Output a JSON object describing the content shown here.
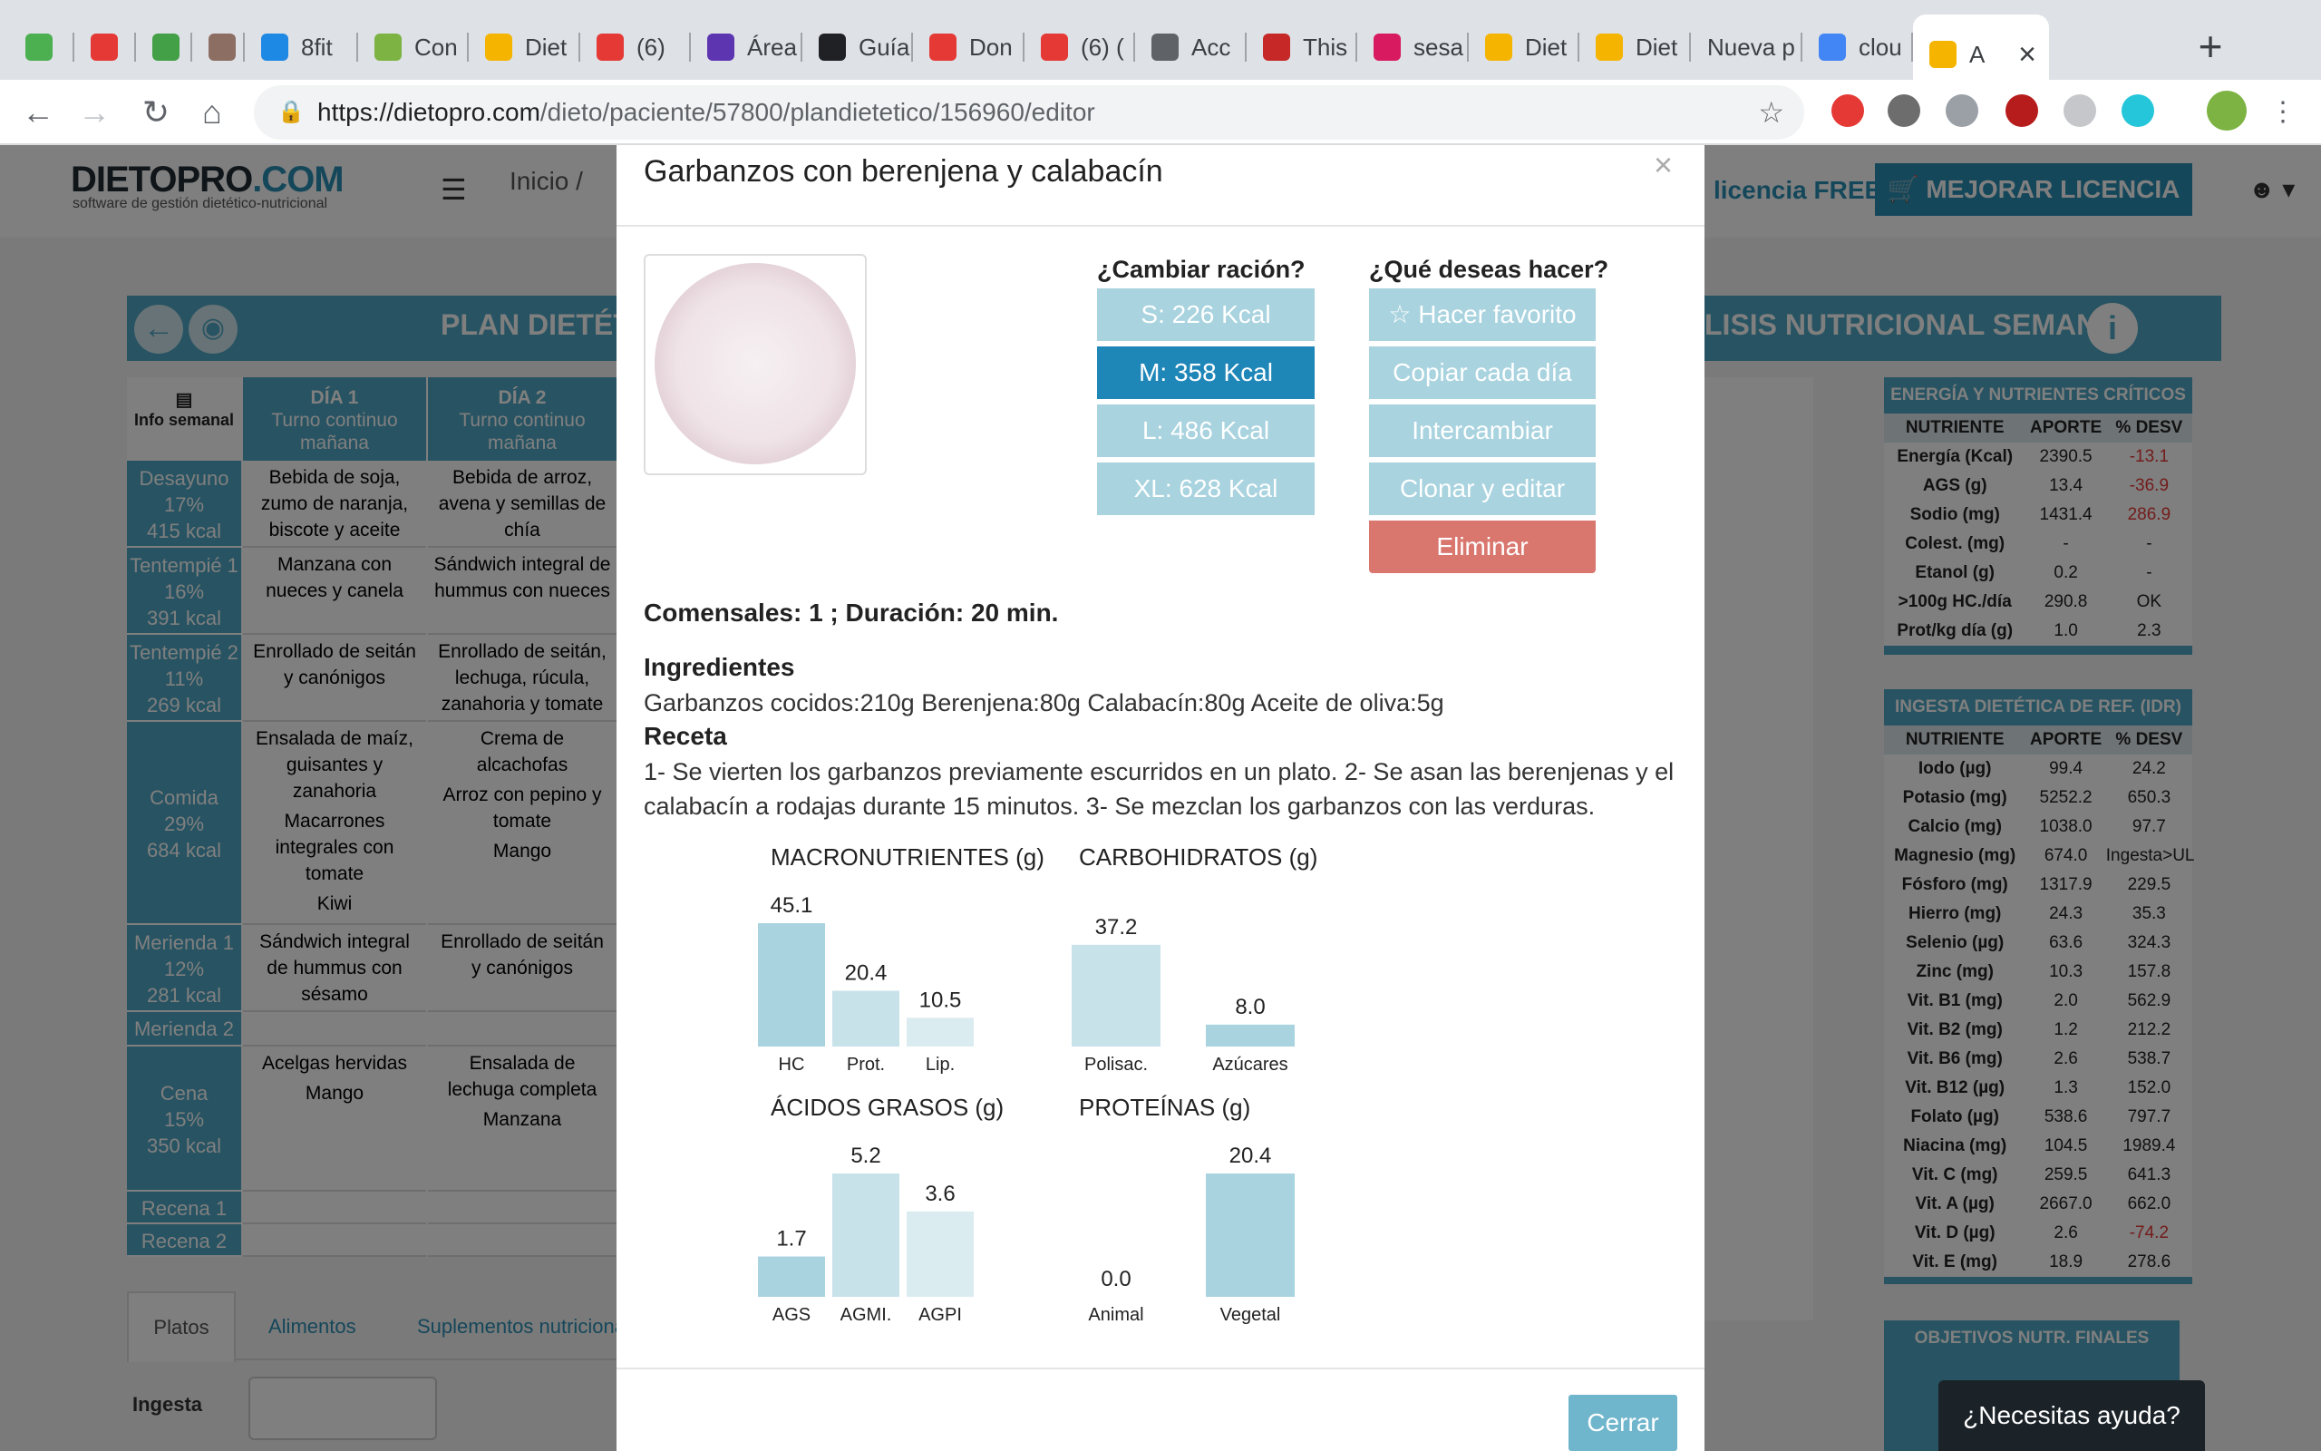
{
  "browser": {
    "tabs": [
      {
        "label": "",
        "color": "#4caf50"
      },
      {
        "label": "",
        "color": "#e53935"
      },
      {
        "label": "",
        "color": "#43a047"
      },
      {
        "label": "",
        "color": "#8d6e63"
      },
      {
        "label": "8fit",
        "color": "#1e88e5"
      },
      {
        "label": "Con",
        "color": "#7cb342"
      },
      {
        "label": "Diet",
        "color": "#f4b400"
      },
      {
        "label": "(6)",
        "color": "#e53935"
      },
      {
        "label": "Área",
        "color": "#5e35b1"
      },
      {
        "label": "Guía",
        "color": "#202124"
      },
      {
        "label": "Don",
        "color": "#e53935"
      },
      {
        "label": "(6) (",
        "color": "#e53935"
      },
      {
        "label": "Acc",
        "color": "#5f6368"
      },
      {
        "label": "This",
        "color": "#c62828"
      },
      {
        "label": "sesa",
        "color": "#d81b60"
      },
      {
        "label": "Diet",
        "color": "#f4b400"
      },
      {
        "label": "Diet",
        "color": "#f4b400"
      },
      {
        "label": "Nueva p",
        "color": ""
      },
      {
        "label": "clou",
        "color": "#4285f4"
      },
      {
        "label": "A",
        "color": "#f4b400"
      }
    ],
    "new_tab": "+",
    "close_tab": "×",
    "url_host": "https://dietopro.com",
    "url_path": "/dieto/paciente/57800/plandietetico/156960/editor"
  },
  "site": {
    "logo": "DIETOPRO",
    "logo_suffix": ".COM",
    "logo_sub": "software de gestión dietético-nutricional",
    "breadcrumb": "Inicio /",
    "licence": "licencia FREE",
    "upgrade": "MEJORAR LICENCIA",
    "plan_title": "PLAN DIETÉTI",
    "analysis_title": "LISIS NUTRICIONAL SEMANAL",
    "info_semanal": "Info semanal",
    "day1": "DÍA 1",
    "day1_sub": "Turno continuo mañana",
    "day2": "DÍA 2",
    "day2_sub": "Turno continuo mañana",
    "meals": [
      {
        "name": "Desayuno",
        "pct": "17%",
        "kcal": "415 kcal",
        "d1": "Bebida de soja, zumo de naranja, biscote y aceite",
        "d2": "Bebida de arroz, avena y semillas de chía"
      },
      {
        "name": "Tentempié 1",
        "pct": "16%",
        "kcal": "391 kcal",
        "d1": "Manzana con nueces y canela",
        "d2": "Sándwich integral de hummus con nueces"
      },
      {
        "name": "Tentempié 2",
        "pct": "11%",
        "kcal": "269 kcal",
        "d1": "Enrollado de seitán y canónigos",
        "d2": "Enrollado de seitán, lechuga, rúcula, zanahoria y tomate"
      },
      {
        "name": "Comida",
        "pct": "29%",
        "kcal": "684 kcal",
        "d1": "Ensalada de maíz, guisantes y zanahoria / Macarrones integrales con tomate / Kiwi",
        "d2": "Crema de alcachofas / Arroz con pepino y tomate / Mango"
      },
      {
        "name": "Merienda 1",
        "pct": "12%",
        "kcal": "281 kcal",
        "d1": "Sándwich integral de hummus con sésamo",
        "d2": "Enrollado de seitán y canónigos"
      },
      {
        "name": "Merienda 2",
        "pct": "",
        "kcal": "",
        "d1": "",
        "d2": ""
      },
      {
        "name": "Cena",
        "pct": "15%",
        "kcal": "350 kcal",
        "d1": "Acelgas hervidas / Mango",
        "d2": "Ensalada de lechuga completa / Manzana"
      },
      {
        "name": "Recena 1",
        "pct": "",
        "kcal": "",
        "d1": "",
        "d2": ""
      },
      {
        "name": "Recena 2",
        "pct": "",
        "kcal": "",
        "d1": "",
        "d2": ""
      }
    ],
    "bottom_tabs": [
      "Platos",
      "Alimentos",
      "Suplementos nutriciona"
    ],
    "ingesta_label": "Ingesta",
    "energy_table": {
      "title": "ENERGÍA Y NUTRIENTES CRÍTICOS",
      "headers": [
        "NUTRIENTE",
        "APORTE",
        "% DESV"
      ],
      "rows": [
        [
          "Energía (Kcal)",
          "2390.5",
          "-13.1"
        ],
        [
          "AGS (g)",
          "13.4",
          "-36.9"
        ],
        [
          "Sodio (mg)",
          "1431.4",
          "286.9"
        ],
        [
          "Colest. (mg)",
          "-",
          "-"
        ],
        [
          "Etanol (g)",
          "0.2",
          "-"
        ],
        [
          ">100g HC./día",
          "290.8",
          "OK"
        ],
        [
          "Prot/kg día (g)",
          "1.0",
          "2.3"
        ]
      ]
    },
    "idr_table": {
      "title": "INGESTA DIETÉTICA DE REF. (IDR)",
      "headers": [
        "NUTRIENTE",
        "APORTE",
        "% DESV"
      ],
      "rows": [
        [
          "Iodo (µg)",
          "99.4",
          "24.2"
        ],
        [
          "Potasio (mg)",
          "5252.2",
          "650.3"
        ],
        [
          "Calcio (mg)",
          "1038.0",
          "97.7"
        ],
        [
          "Magnesio (mg)",
          "674.0",
          "Ingesta>UL"
        ],
        [
          "Fósforo (mg)",
          "1317.9",
          "229.5"
        ],
        [
          "Hierro (mg)",
          "24.3",
          "35.3"
        ],
        [
          "Selenio (µg)",
          "63.6",
          "324.3"
        ],
        [
          "Zinc (mg)",
          "10.3",
          "157.8"
        ],
        [
          "Vit. B1 (mg)",
          "2.0",
          "562.9"
        ],
        [
          "Vit. B2 (mg)",
          "1.2",
          "212.2"
        ],
        [
          "Vit. B6 (mg)",
          "2.6",
          "538.7"
        ],
        [
          "Vit. B12 (µg)",
          "1.3",
          "152.0"
        ],
        [
          "Folato (µg)",
          "538.6",
          "797.7"
        ],
        [
          "Niacina (mg)",
          "104.5",
          "1989.4"
        ],
        [
          "Vit. C (mg)",
          "259.5",
          "641.3"
        ],
        [
          "Vit. A (µg)",
          "2667.0",
          "662.0"
        ],
        [
          "Vit. D (µg)",
          "2.6",
          "-74.2"
        ],
        [
          "Vit. E (mg)",
          "18.9",
          "278.6"
        ]
      ]
    },
    "objectives_title": "OBJETIVOS NUTR. FINALES",
    "help": "¿Necesitas ayuda?"
  },
  "modal": {
    "title": "Garbanzos con berenjena y calabacín",
    "close_x": "×",
    "portion_heading": "¿Cambiar ración?",
    "portions": [
      {
        "label": "S: 226 Kcal",
        "selected": false
      },
      {
        "label": "M: 358 Kcal",
        "selected": true
      },
      {
        "label": "L: 486 Kcal",
        "selected": false
      },
      {
        "label": "XL: 628 Kcal",
        "selected": false
      }
    ],
    "actions_heading": "¿Qué deseas hacer?",
    "actions": {
      "favorite": "Hacer favorito",
      "copy": "Copiar cada día",
      "swap": "Intercambiar",
      "clone": "Clonar y editar",
      "delete": "Eliminar"
    },
    "meta": "Comensales: 1 ; Duración: 20 min.",
    "ingredients_heading": "Ingredientes",
    "ingredients": "Garbanzos cocidos:210g Berenjena:80g Calabacín:80g Aceite de oliva:5g",
    "recipe_heading": "Receta",
    "recipe": "1- Se vierten los garbanzos previamente escurridos en un plato. 2- Se asan las berenjenas y el calabacín a rodajas durante 15 minutos. 3- Se mezclan los garbanzos con las verduras.",
    "close_button": "Cerrar",
    "colors": {
      "bar_dark": "#a8d3df",
      "bar_mid": "#c8e2ea",
      "bar_light": "#dbecf1",
      "accent": "#1f86b8",
      "danger": "#d9776f"
    }
  },
  "chart_data": [
    {
      "type": "bar",
      "title": "MACRONUTRIENTES (g)",
      "categories": [
        "HC",
        "Prot.",
        "Lip."
      ],
      "values": [
        45.1,
        20.4,
        10.5
      ]
    },
    {
      "type": "bar",
      "title": "CARBOHIDRATOS (g)",
      "categories": [
        "Polisac.",
        "Azúcares"
      ],
      "values": [
        37.2,
        8.0
      ]
    },
    {
      "type": "bar",
      "title": "ÁCIDOS GRASOS (g)",
      "categories": [
        "AGS",
        "AGMI.",
        "AGPI"
      ],
      "values": [
        1.7,
        5.2,
        3.6
      ]
    },
    {
      "type": "bar",
      "title": "PROTEÍNAS (g)",
      "categories": [
        "Animal",
        "Vegetal"
      ],
      "values": [
        0.0,
        20.4
      ]
    }
  ]
}
